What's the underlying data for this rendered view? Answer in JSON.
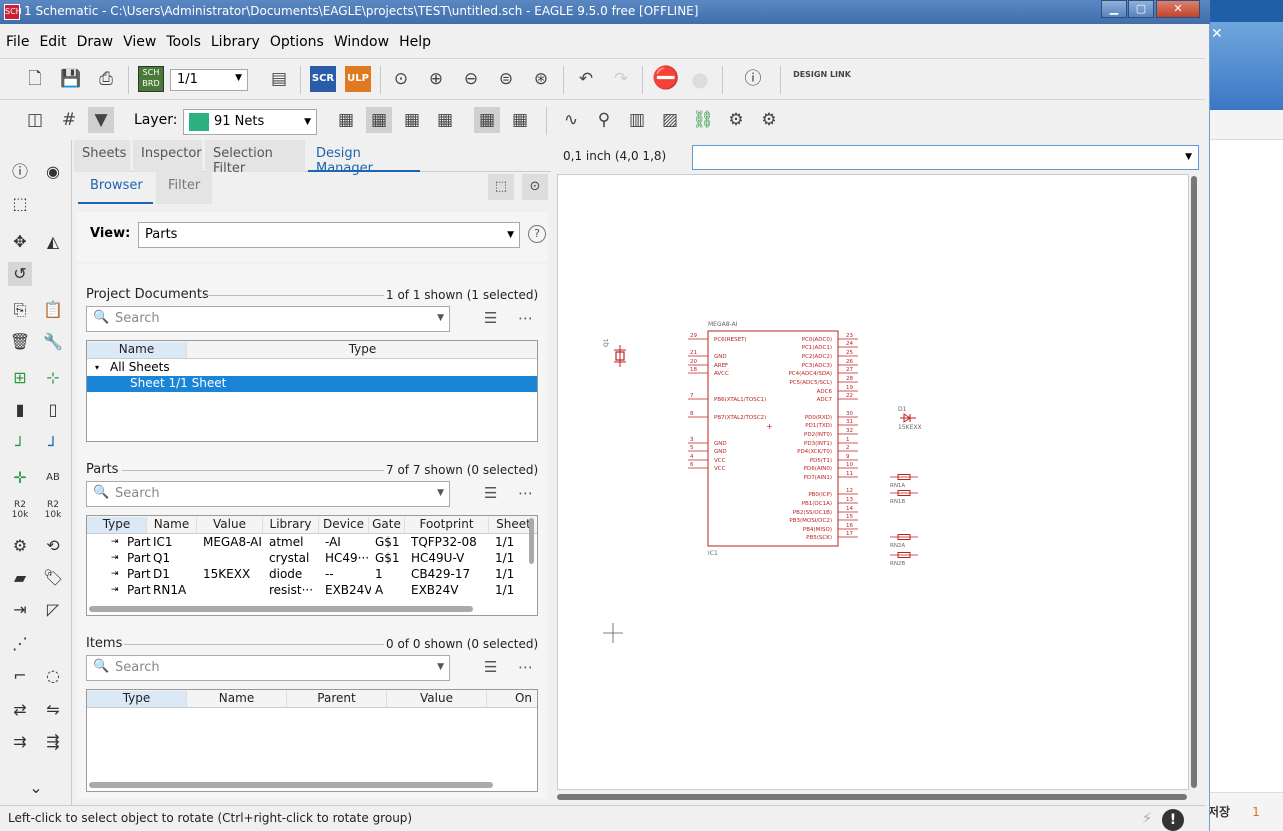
{
  "window": {
    "title": "1 Schematic - C:\\Users\\Administrator\\Documents\\EAGLE\\projects\\TEST\\untitled.sch - EAGLE 9.5.0 free [OFFLINE]",
    "app_icon": "SCH",
    "min": "▁",
    "max": "▢",
    "close": "✕"
  },
  "background_window": {
    "close": "✕",
    "status_text": "저장",
    "status_count": "1"
  },
  "menu": [
    "File",
    "Edit",
    "Draw",
    "View",
    "Tools",
    "Library",
    "Options",
    "Window",
    "Help"
  ],
  "toolbar1": {
    "sheet_select": "1/1",
    "sch_brd": "SCH BRD",
    "scr": "SCR",
    "ulp": "ULP",
    "design_link": "DESIGN LINK"
  },
  "toolbar2": {
    "layer_label": "Layer:",
    "layer_value": "91 Nets",
    "layer_color": "#2eb082"
  },
  "panel": {
    "tabs": [
      "Sheets",
      "Inspector",
      "Selection Filter",
      "Design Manager"
    ],
    "active_tab": "Design Manager",
    "subtabs": [
      "Browser",
      "Filter"
    ],
    "view_label": "View:",
    "view_value": "Parts",
    "help": "?",
    "project_docs": {
      "label": "Project Documents",
      "count": "1 of 1 shown (1 selected)",
      "search_placeholder": "Search",
      "columns": [
        "Name",
        "Type"
      ],
      "rows": [
        {
          "name": "All Sheets",
          "type": ""
        },
        {
          "name": "Sheet 1/1 Sheet",
          "type": ""
        }
      ]
    },
    "parts": {
      "label": "Parts",
      "count": "7 of 7 shown (0 selected)",
      "search_placeholder": "Search",
      "columns": [
        "Type",
        "Name",
        "Value",
        "Library",
        "Device",
        "Gate",
        "Footprint",
        "Sheet"
      ],
      "rows": [
        [
          "Part",
          "IC1",
          "MEGA8-AI",
          "atmel",
          "-AI",
          "G$1",
          "TQFP32-08",
          "1/1"
        ],
        [
          "Part",
          "Q1",
          "",
          "crystal",
          "HC49···",
          "G$1",
          "HC49U-V",
          "1/1"
        ],
        [
          "Part",
          "D1",
          "15KEXX",
          "diode",
          "--",
          "1",
          "CB429-17",
          "1/1"
        ],
        [
          "Part",
          "RN1A",
          "",
          "resist···",
          "EXB24V",
          "A",
          "EXB24V",
          "1/1"
        ]
      ]
    },
    "items": {
      "label": "Items",
      "count": "0 of 0 shown (0 selected)",
      "search_placeholder": "Search",
      "columns": [
        "Type",
        "Name",
        "Parent",
        "Value",
        "On"
      ]
    }
  },
  "canvas": {
    "coords": "0,1 inch (4,0 1,8)",
    "command": ""
  },
  "schematic": {
    "ic_name": "MEGA8-AI",
    "ic_ref": "IC1",
    "left_pins": [
      {
        "num": "29",
        "name": "PC6(RESET)"
      },
      {
        "num": "21",
        "name": "GND"
      },
      {
        "num": "20",
        "name": "AREF"
      },
      {
        "num": "18",
        "name": "AVCC"
      },
      {
        "num": "7",
        "name": "PB6(XTAL1/TOSC1)"
      },
      {
        "num": "8",
        "name": "PB7(XTAL2/TOSC2)"
      },
      {
        "num": "3",
        "name": "GND"
      },
      {
        "num": "5",
        "name": "GND"
      },
      {
        "num": "4",
        "name": "VCC"
      },
      {
        "num": "6",
        "name": "VCC"
      }
    ],
    "right_pins": [
      {
        "num": "23",
        "name": "PC0(ADC0)"
      },
      {
        "num": "24",
        "name": "PC1(ADC1)"
      },
      {
        "num": "25",
        "name": "PC2(ADC2)"
      },
      {
        "num": "26",
        "name": "PC3(ADC3)"
      },
      {
        "num": "27",
        "name": "PC4(ADC4/SDA)"
      },
      {
        "num": "28",
        "name": "PC5(ADC5/SCL)"
      },
      {
        "num": "19",
        "name": "ADC6"
      },
      {
        "num": "22",
        "name": "ADC7"
      },
      {
        "num": "30",
        "name": "PD0(RXD)"
      },
      {
        "num": "31",
        "name": "PD1(TXD)"
      },
      {
        "num": "32",
        "name": "PD2(INT0)"
      },
      {
        "num": "1",
        "name": "PD3(INT1)"
      },
      {
        "num": "2",
        "name": "PD4(XCK/T0)"
      },
      {
        "num": "9",
        "name": "PD5(T1)"
      },
      {
        "num": "10",
        "name": "PD6(AIN0)"
      },
      {
        "num": "11",
        "name": "PD7(AIN1)"
      },
      {
        "num": "12",
        "name": "PB0(ICP)"
      },
      {
        "num": "13",
        "name": "PB1(OC1A)"
      },
      {
        "num": "14",
        "name": "PB2(SS/OC1B)"
      },
      {
        "num": "15",
        "name": "PB3(MOSI/OC2)"
      },
      {
        "num": "16",
        "name": "PB4(MISO)"
      },
      {
        "num": "17",
        "name": "PB5(SCK)"
      }
    ],
    "q1_ref": "Q1",
    "d1_ref": "D1",
    "d1_value": "15KEXX",
    "rn_labels": [
      "RN1A",
      "RN1B",
      "RN2A",
      "RN2B"
    ]
  },
  "status": {
    "message": "Left-click to select object to rotate (Ctrl+right-click to rotate group)",
    "warn": "!"
  }
}
